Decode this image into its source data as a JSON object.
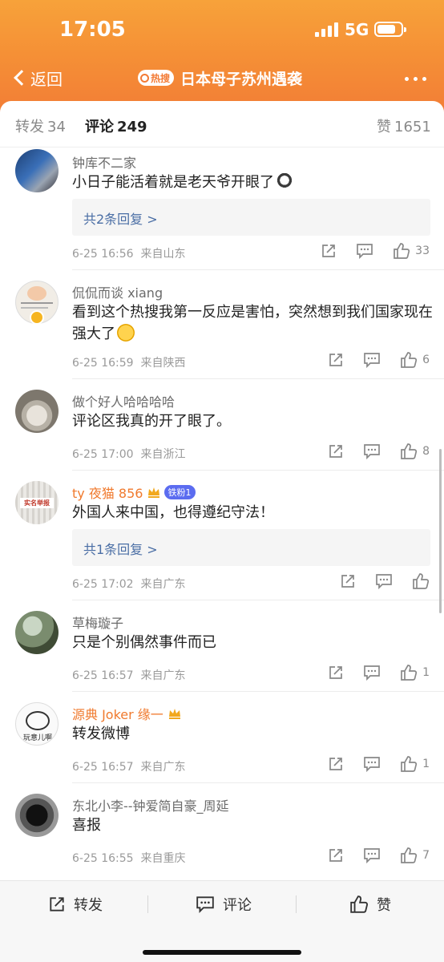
{
  "status": {
    "time": "17:05",
    "network": "5G"
  },
  "nav": {
    "back_label": "返回",
    "hot_badge": "热搜",
    "title": "日本母子苏州遇袭"
  },
  "tabs": [
    {
      "label": "转发",
      "count": "34"
    },
    {
      "label": "评论",
      "count": "249"
    },
    {
      "label": "赞",
      "count": "1651"
    }
  ],
  "comments": [
    {
      "user": "钟库不二家",
      "text": "小日子能活着就是老天爷开眼了",
      "reply": "共2条回复 >",
      "date": "6-25 16:56",
      "location": "来自山东",
      "likes": "33",
      "avatar_icon": "avatar-photo"
    },
    {
      "user": "侃侃而谈 xiang",
      "text": "看到这个热搜我第一反应是害怕，突然想到我们国家现在强大了",
      "reply": "",
      "date": "6-25 16:59",
      "location": "来自陕西",
      "likes": "6",
      "avatar_icon": "avatar-cartoon"
    },
    {
      "user": "做个好人哈哈哈哈",
      "text": "评论区我真的开了眼了。",
      "reply": "",
      "date": "6-25 17:00",
      "location": "来自浙江",
      "likes": "8",
      "avatar_icon": "avatar-sculpture"
    },
    {
      "user": "ty 夜猫 856",
      "fan_badge": "铁粉1",
      "text": "外国人来中国，也得遵纪守法！",
      "reply": "共1条回复 >",
      "date": "6-25 17:02",
      "location": "来自广东",
      "likes": "",
      "avatar_icon": "avatar-notice",
      "avatar_text": "实名举报"
    },
    {
      "user": "草梅璇子",
      "text": "只是个别偶然事件而已",
      "reply": "",
      "date": "6-25 16:57",
      "location": "来自广东",
      "likes": "1",
      "avatar_icon": "avatar-statue"
    },
    {
      "user": "源典 Joker 缘一",
      "text": "转发微博",
      "reply": "",
      "date": "6-25 16:57",
      "location": "来自广东",
      "likes": "1",
      "avatar_icon": "avatar-meme",
      "avatar_text": "玩意儿啊"
    },
    {
      "user": "东北小李--钟爱简自豪_周延",
      "text": "喜报",
      "reply": "",
      "date": "6-25 16:55",
      "location": "来自重庆",
      "likes": "7",
      "avatar_icon": "avatar-well"
    }
  ],
  "bottom_bar": {
    "repost": "转发",
    "comment": "评论",
    "like": "赞"
  },
  "colors": {
    "header": "#f59036",
    "link": "#4a6ea5",
    "vip_name": "#f07a2e"
  }
}
